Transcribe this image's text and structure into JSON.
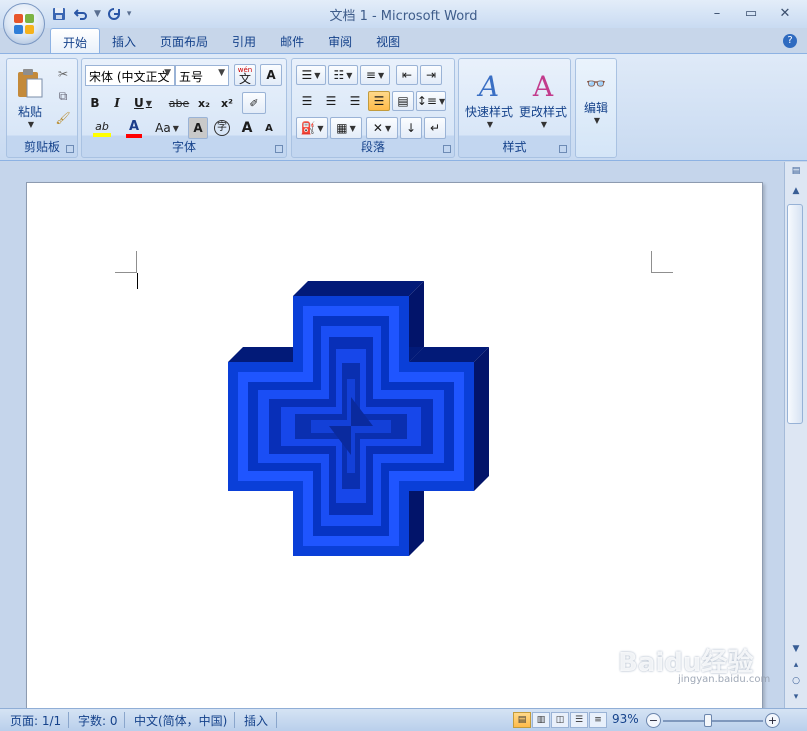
{
  "window": {
    "title": "文档 1 - Microsoft Word",
    "minimize_glyph": "–",
    "maximize_glyph": "▭",
    "close_glyph": "✕"
  },
  "qat": {
    "save_icon": "save-icon",
    "undo_icon": "undo-icon",
    "redo_icon": "redo-icon"
  },
  "tabs": [
    "开始",
    "插入",
    "页面布局",
    "引用",
    "邮件",
    "审阅",
    "视图"
  ],
  "active_tab": "开始",
  "help_label": "?",
  "ribbon": {
    "clipboard": {
      "label": "剪贴板",
      "paste_label": "粘贴"
    },
    "font": {
      "label": "字体",
      "font_name": "宋体 (中文正文",
      "font_size": "五号",
      "bold": "B",
      "italic": "I",
      "underline": "U",
      "strike": "abe",
      "subscript": "x₂",
      "superscript": "x²",
      "grow": "A",
      "shrink": "A",
      "case": "Aa",
      "char_shading": "A",
      "enclose": "字",
      "phonetic": "wén",
      "phonetic_char": "文",
      "border_char": "A",
      "highlight": "ab",
      "font_color": "A",
      "highlight_color": "#ffff00",
      "font_color_bar": "#ff0000"
    },
    "paragraph": {
      "label": "段落"
    },
    "styles": {
      "label": "样式",
      "quick_styles": "快速样式",
      "change_styles": "更改样式"
    },
    "editing": {
      "label": "编辑"
    }
  },
  "status": {
    "page": "页面: 1/1",
    "words": "字数: 0",
    "language": "中文(简体，中国)",
    "insert": "插入",
    "zoom": "93%",
    "zoom_minus": "−",
    "zoom_plus": "+"
  },
  "watermark": {
    "text": "Baidu经验",
    "url": "jingyan.baidu.com"
  },
  "colors": {
    "shape_outer": "#0a3fd8",
    "shape_dark": "#021a78",
    "shape_center": "#0a2fb0"
  }
}
